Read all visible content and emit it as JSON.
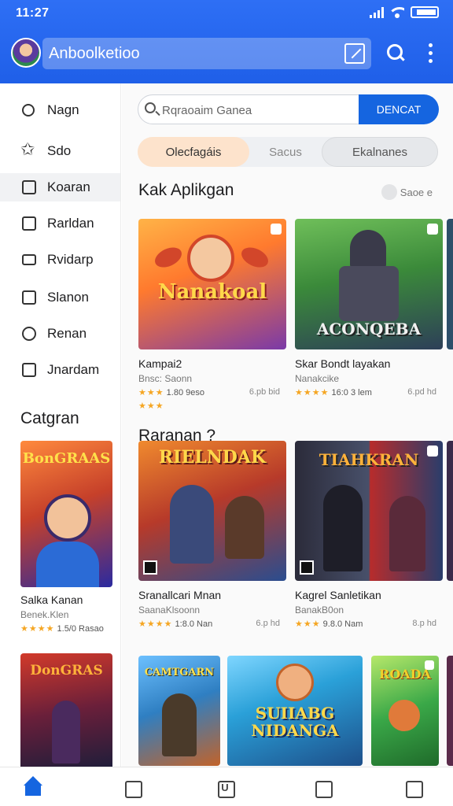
{
  "status": {
    "time": "11:27"
  },
  "appbar": {
    "title": "Anboolketioo"
  },
  "sidebar": {
    "items": [
      {
        "label": "Nagn",
        "icon": "search-icon"
      },
      {
        "label": "Sdo",
        "icon": "star-icon"
      },
      {
        "label": "Koaran",
        "icon": "square-icon"
      },
      {
        "label": "Rarldan",
        "icon": "edit-icon"
      },
      {
        "label": "Rvidarp",
        "icon": "keyboard-icon"
      },
      {
        "label": "Slanon",
        "icon": "chart-icon"
      },
      {
        "label": "Renan",
        "icon": "puzzle-icon"
      },
      {
        "label": "Jnardam",
        "icon": "bag-icon"
      }
    ],
    "category_title": "Catgran",
    "cards": [
      {
        "name": "Salka Kanan",
        "sub": "Benek.Klen",
        "rating": "★★★★",
        "meta": "1.5/0 Rasao",
        "art": "BonGRAAS",
        "colors": [
          "#ff6b2b",
          "#2a2aa0"
        ]
      },
      {
        "name": "",
        "sub": "",
        "rating": "",
        "meta": "",
        "art": "DonGRAS",
        "colors": [
          "#c53030",
          "#1d1d3a"
        ]
      }
    ]
  },
  "main": {
    "search": {
      "placeholder": "Rqraoaim Ganea",
      "button": "DENCAT"
    },
    "chips": [
      "Olecfagáis",
      "Sacus",
      "Ekalnanes"
    ],
    "section1": {
      "title": "Kak Aplikgan",
      "see_more": "Saoe e",
      "cards": [
        {
          "name": "Kampai2",
          "sub": "Bnsc: Saonn",
          "rating": "★★★",
          "meta": "1.80 9eso",
          "size": "6.pb bid",
          "extra": "★★★",
          "art": "Nanakoal",
          "colors": [
            "#ff9a2e",
            "#5b2a86"
          ]
        },
        {
          "name": "Skar Bondt layakan",
          "sub": "Nanakcike",
          "rating": "★★★★",
          "meta": "16:0 3 lem",
          "size": "6.pd hd",
          "art": "ACONQEBA",
          "colors": [
            "#3b8a3a",
            "#2d3f58"
          ]
        }
      ]
    },
    "section2": {
      "title": "Raranan ?",
      "cards": [
        {
          "name": "Sranallcari Mnan",
          "sub": "SaanaKlsoonn",
          "rating": "★★★★",
          "meta": "1:8.0 Nan",
          "size": "6.p hd",
          "art": "RIELNDAK",
          "colors": [
            "#d84a1f",
            "#2a4d8f"
          ]
        },
        {
          "name": "Kagrel Sanletikan",
          "sub": "BanakB0on",
          "rating": "★★★",
          "meta": "9.8.0 Nam",
          "size": "8.p hd",
          "art": "TIAHKRAN",
          "colors": [
            "#2a3d6b",
            "#b72c2c"
          ]
        }
      ]
    },
    "section3": {
      "cards": [
        {
          "art": "CAMTGARN",
          "colors": [
            "#2f7fc2",
            "#c2632a"
          ]
        },
        {
          "art": "SUIIABG NIDANGA",
          "colors": [
            "#2aa0d8",
            "#f0a030"
          ]
        },
        {
          "art": "ROADA",
          "colors": [
            "#3aa848",
            "#f2d02a"
          ]
        }
      ]
    }
  },
  "bottomnav": {
    "items": [
      {
        "icon": "home-icon",
        "glyph": ""
      },
      {
        "icon": "shield-icon",
        "glyph": ""
      },
      {
        "icon": "tablet-icon",
        "glyph": "U"
      },
      {
        "icon": "mail-icon",
        "glyph": ""
      },
      {
        "icon": "briefcase-icon",
        "glyph": ""
      }
    ]
  },
  "theme": {
    "primary": "#1f5fe8",
    "accent_button": "#1565e0",
    "chip_active": "#fde3cc",
    "star": "#f5a623"
  }
}
